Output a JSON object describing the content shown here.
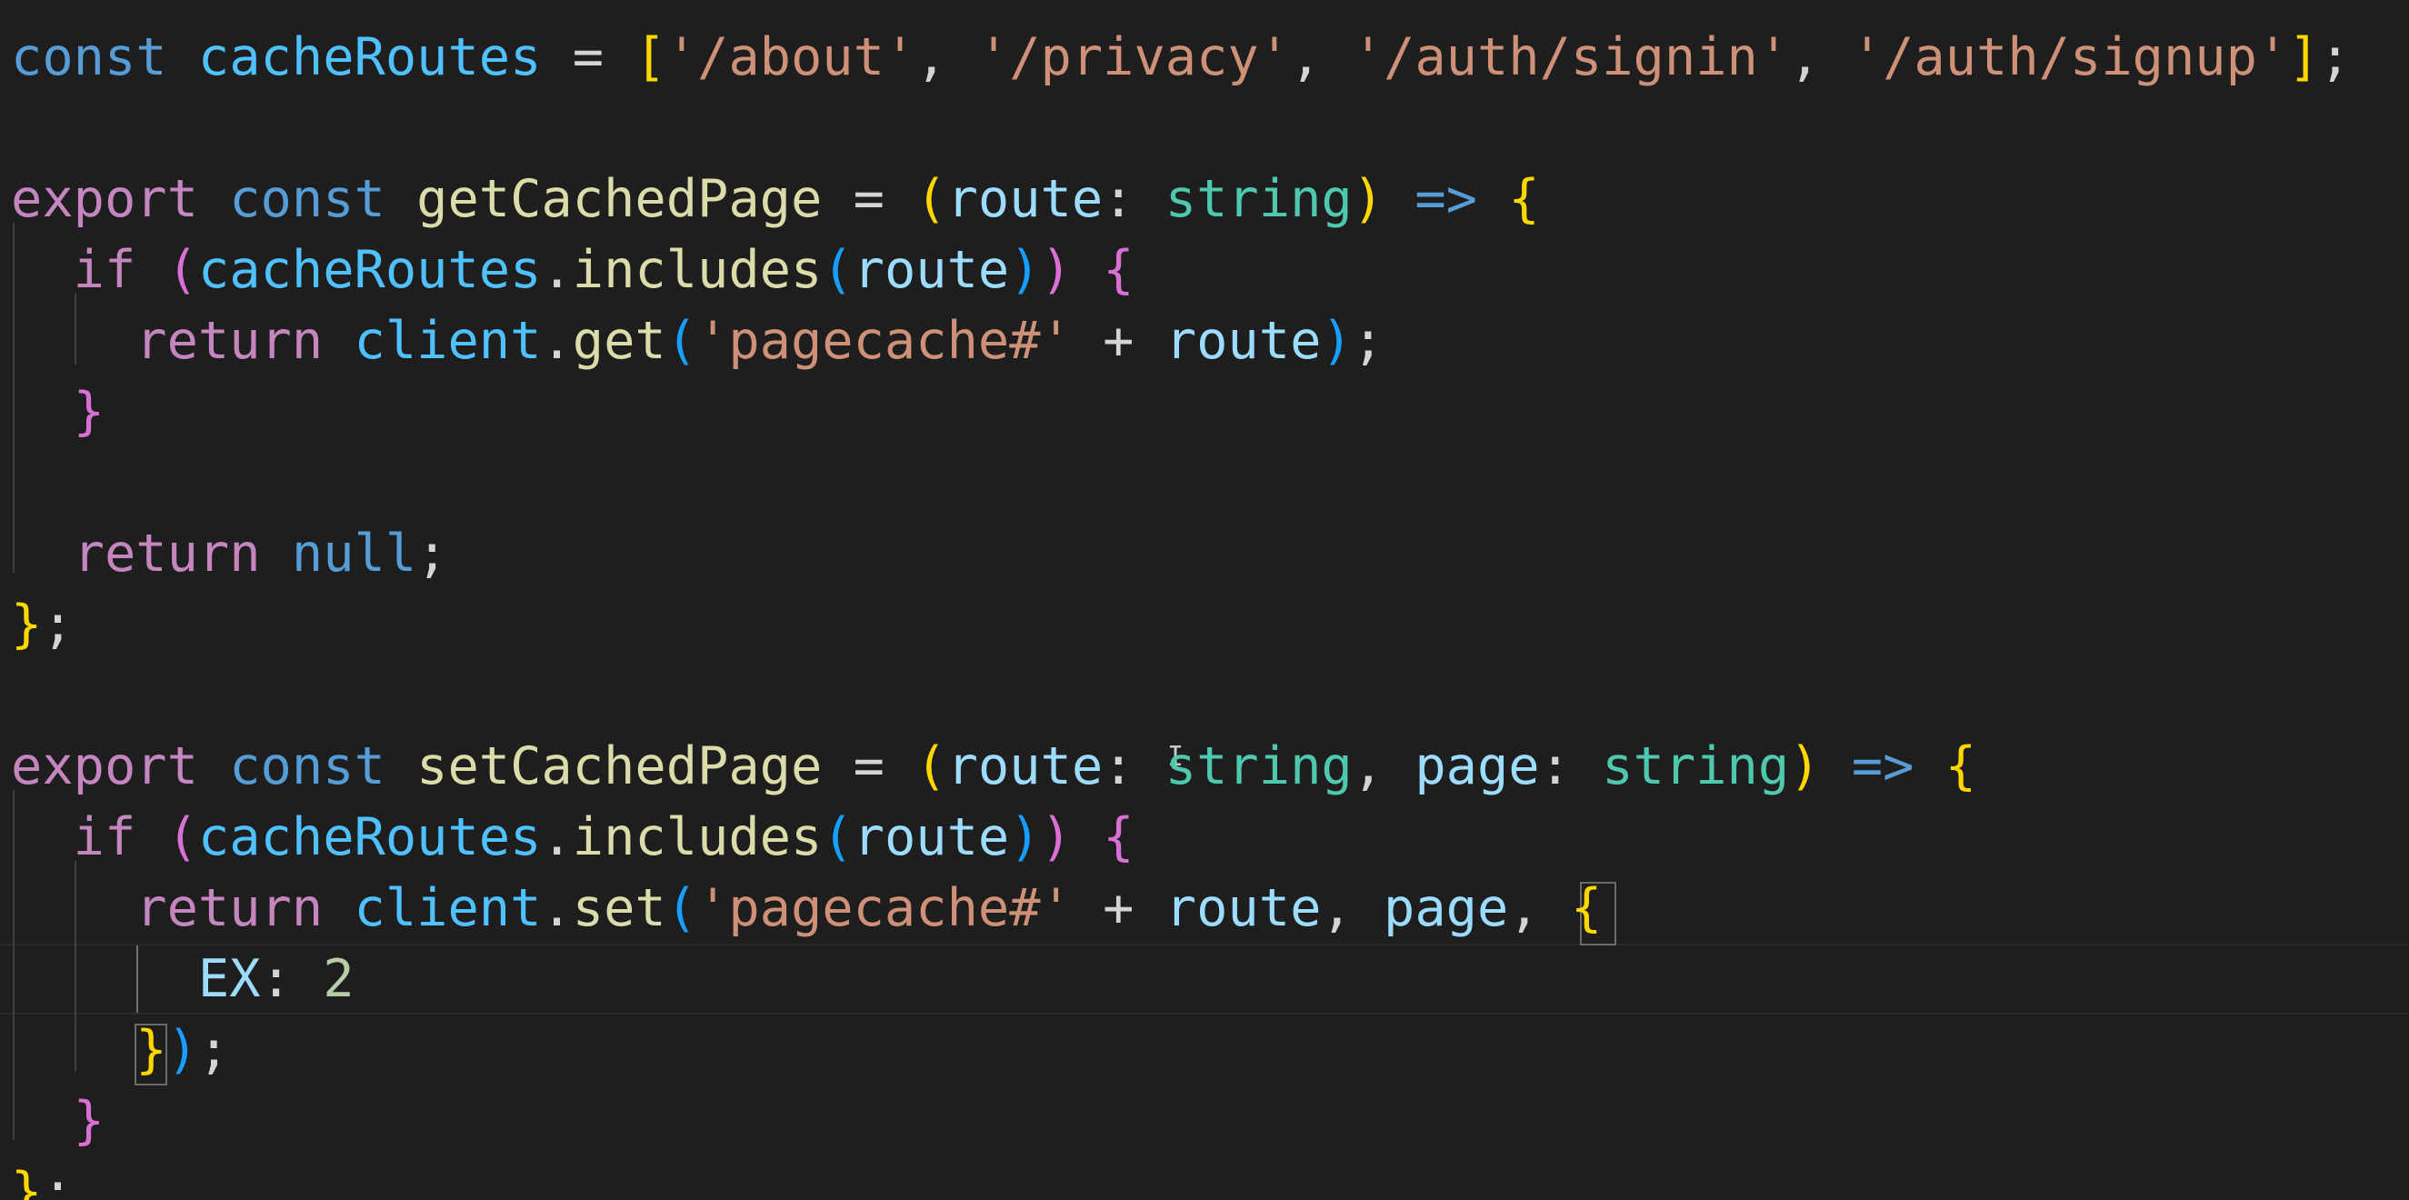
{
  "editor": {
    "lines": [
      {
        "tokens": [
          {
            "t": "const",
            "c": "kw-c"
          },
          {
            "t": " "
          },
          {
            "t": "cacheRoutes",
            "c": "var"
          },
          {
            "t": " = ",
            "c": "op"
          },
          {
            "t": "[",
            "c": "bracket-y"
          },
          {
            "t": "'/about'",
            "c": "str"
          },
          {
            "t": ", ",
            "c": "punct"
          },
          {
            "t": "'/privacy'",
            "c": "str"
          },
          {
            "t": ", ",
            "c": "punct"
          },
          {
            "t": "'/auth/signin'",
            "c": "str"
          },
          {
            "t": ", ",
            "c": "punct"
          },
          {
            "t": "'/auth/signup'",
            "c": "str"
          },
          {
            "t": "]",
            "c": "bracket-y"
          },
          {
            "t": ";",
            "c": "punct"
          }
        ]
      },
      {
        "tokens": []
      },
      {
        "tokens": [
          {
            "t": "export",
            "c": "kw-p"
          },
          {
            "t": " "
          },
          {
            "t": "const",
            "c": "kw-c"
          },
          {
            "t": " "
          },
          {
            "t": "getCachedPage",
            "c": "fn"
          },
          {
            "t": " = ",
            "c": "op"
          },
          {
            "t": "(",
            "c": "bracket-y"
          },
          {
            "t": "route",
            "c": "param"
          },
          {
            "t": ": ",
            "c": "punct"
          },
          {
            "t": "string",
            "c": "type"
          },
          {
            "t": ")",
            "c": "bracket-y"
          },
          {
            "t": " "
          },
          {
            "t": "=>",
            "c": "arrow"
          },
          {
            "t": " "
          },
          {
            "t": "{",
            "c": "bracket-y"
          }
        ]
      },
      {
        "tokens": [
          {
            "t": "  "
          },
          {
            "t": "if",
            "c": "kw-p"
          },
          {
            "t": " "
          },
          {
            "t": "(",
            "c": "bracket-p"
          },
          {
            "t": "cacheRoutes",
            "c": "var"
          },
          {
            "t": ".",
            "c": "punct"
          },
          {
            "t": "includes",
            "c": "fn"
          },
          {
            "t": "(",
            "c": "bracket-b"
          },
          {
            "t": "route",
            "c": "param"
          },
          {
            "t": ")",
            "c": "bracket-b"
          },
          {
            "t": ")",
            "c": "bracket-p"
          },
          {
            "t": " "
          },
          {
            "t": "{",
            "c": "bracket-p"
          }
        ]
      },
      {
        "tokens": [
          {
            "t": "    "
          },
          {
            "t": "return",
            "c": "kw-p"
          },
          {
            "t": " "
          },
          {
            "t": "client",
            "c": "var"
          },
          {
            "t": ".",
            "c": "punct"
          },
          {
            "t": "get",
            "c": "fn"
          },
          {
            "t": "(",
            "c": "bracket-b"
          },
          {
            "t": "'pagecache#'",
            "c": "str"
          },
          {
            "t": " + ",
            "c": "op"
          },
          {
            "t": "route",
            "c": "param"
          },
          {
            "t": ")",
            "c": "bracket-b"
          },
          {
            "t": ";",
            "c": "punct"
          }
        ]
      },
      {
        "tokens": [
          {
            "t": "  "
          },
          {
            "t": "}",
            "c": "bracket-p"
          }
        ]
      },
      {
        "tokens": []
      },
      {
        "tokens": [
          {
            "t": "  "
          },
          {
            "t": "return",
            "c": "kw-p"
          },
          {
            "t": " "
          },
          {
            "t": "null",
            "c": "kw-c"
          },
          {
            "t": ";",
            "c": "punct"
          }
        ]
      },
      {
        "tokens": [
          {
            "t": "}",
            "c": "bracket-y"
          },
          {
            "t": ";",
            "c": "punct"
          }
        ]
      },
      {
        "tokens": []
      },
      {
        "tokens": [
          {
            "t": "export",
            "c": "kw-p"
          },
          {
            "t": " "
          },
          {
            "t": "const",
            "c": "kw-c"
          },
          {
            "t": " "
          },
          {
            "t": "setCachedPage",
            "c": "fn"
          },
          {
            "t": " = ",
            "c": "op"
          },
          {
            "t": "(",
            "c": "bracket-y"
          },
          {
            "t": "route",
            "c": "param"
          },
          {
            "t": ": ",
            "c": "punct"
          },
          {
            "t": "string",
            "c": "type"
          },
          {
            "t": ", ",
            "c": "punct"
          },
          {
            "t": "page",
            "c": "param"
          },
          {
            "t": ": ",
            "c": "punct"
          },
          {
            "t": "string",
            "c": "type"
          },
          {
            "t": ")",
            "c": "bracket-y"
          },
          {
            "t": " "
          },
          {
            "t": "=>",
            "c": "arrow"
          },
          {
            "t": " "
          },
          {
            "t": "{",
            "c": "bracket-y"
          }
        ]
      },
      {
        "tokens": [
          {
            "t": "  "
          },
          {
            "t": "if",
            "c": "kw-p"
          },
          {
            "t": " "
          },
          {
            "t": "(",
            "c": "bracket-p"
          },
          {
            "t": "cacheRoutes",
            "c": "var"
          },
          {
            "t": ".",
            "c": "punct"
          },
          {
            "t": "includes",
            "c": "fn"
          },
          {
            "t": "(",
            "c": "bracket-b"
          },
          {
            "t": "route",
            "c": "param"
          },
          {
            "t": ")",
            "c": "bracket-b"
          },
          {
            "t": ")",
            "c": "bracket-p"
          },
          {
            "t": " "
          },
          {
            "t": "{",
            "c": "bracket-p"
          }
        ]
      },
      {
        "tokens": [
          {
            "t": "    "
          },
          {
            "t": "return",
            "c": "kw-p"
          },
          {
            "t": " "
          },
          {
            "t": "client",
            "c": "var"
          },
          {
            "t": ".",
            "c": "punct"
          },
          {
            "t": "set",
            "c": "fn"
          },
          {
            "t": "(",
            "c": "bracket-b"
          },
          {
            "t": "'pagecache#'",
            "c": "str"
          },
          {
            "t": " + ",
            "c": "op"
          },
          {
            "t": "route",
            "c": "param"
          },
          {
            "t": ", ",
            "c": "punct"
          },
          {
            "t": "page",
            "c": "param"
          },
          {
            "t": ", ",
            "c": "punct"
          },
          {
            "t": "{",
            "c": "bracket-y"
          }
        ]
      },
      {
        "tokens": [
          {
            "t": "      "
          },
          {
            "t": "EX",
            "c": "param"
          },
          {
            "t": ": ",
            "c": "punct"
          },
          {
            "t": "2",
            "c": "num"
          }
        ]
      },
      {
        "tokens": [
          {
            "t": "    "
          },
          {
            "t": "}",
            "c": "bracket-y"
          },
          {
            "t": ")",
            "c": "bracket-b"
          },
          {
            "t": ";",
            "c": "punct"
          }
        ]
      },
      {
        "tokens": [
          {
            "t": "  "
          },
          {
            "t": "}",
            "c": "bracket-p"
          }
        ]
      },
      {
        "tokens": [
          {
            "t": "}",
            "c": "bracket-y"
          },
          {
            "t": ";",
            "c": "punct"
          }
        ]
      }
    ]
  },
  "colors": {
    "background": "#1e1e1e",
    "keyword_control": "#c586c0",
    "keyword_storage": "#569cd6",
    "variable": "#4fc1ff",
    "function": "#dcdcaa",
    "parameter": "#9cdcfe",
    "type": "#4ec9b0",
    "string": "#ce9178",
    "number": "#b5cea8"
  }
}
